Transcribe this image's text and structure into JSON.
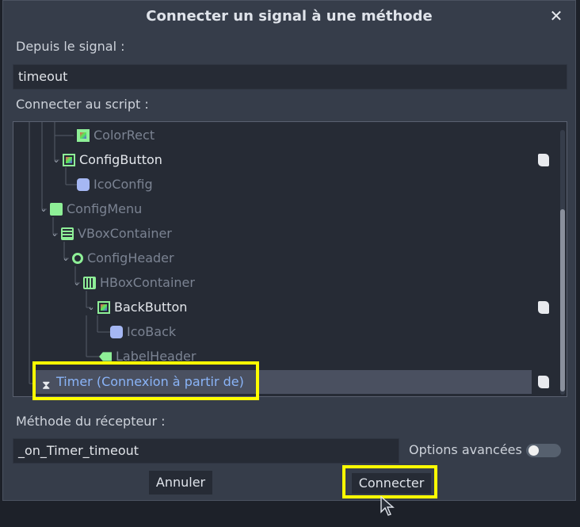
{
  "dialog": {
    "title": "Connecter un signal à une méthode",
    "close_icon": "close-icon"
  },
  "signal_section": {
    "label": "Depuis le signal :",
    "value": "timeout"
  },
  "script_section": {
    "label": "Connecter au script :"
  },
  "tree": {
    "nodes": [
      {
        "label": "ColorRect",
        "icon": "colorrect-icon",
        "dim": true,
        "expanded": false,
        "has_script": false
      },
      {
        "label": "ConfigButton",
        "icon": "texturebutton-icon",
        "dim": false,
        "expanded": true,
        "has_script": true
      },
      {
        "label": "IcoConfig",
        "icon": "sprite-icon",
        "dim": true,
        "expanded": false,
        "has_script": false
      },
      {
        "label": "ConfigMenu",
        "icon": "control-icon",
        "dim": true,
        "expanded": true,
        "has_script": false
      },
      {
        "label": "VBoxContainer",
        "icon": "vbox-icon",
        "dim": true,
        "expanded": true,
        "has_script": false
      },
      {
        "label": "ConfigHeader",
        "icon": "margin-icon",
        "dim": true,
        "expanded": true,
        "has_script": false
      },
      {
        "label": "HBoxContainer",
        "icon": "hbox-icon",
        "dim": true,
        "expanded": true,
        "has_script": false
      },
      {
        "label": "BackButton",
        "icon": "texturebutton-icon",
        "dim": false,
        "expanded": true,
        "has_script": true
      },
      {
        "label": "IcoBack",
        "icon": "sprite-icon",
        "dim": true,
        "expanded": false,
        "has_script": false
      },
      {
        "label": "LabelHeader",
        "icon": "label-icon",
        "dim": true,
        "expanded": false,
        "has_script": false
      }
    ],
    "selected": {
      "label": "Timer (Connexion à partir de)",
      "icon": "hourglass-icon",
      "has_script": true
    }
  },
  "method_section": {
    "label": "Méthode du récepteur :",
    "value": "_on_Timer_timeout",
    "advanced_label": "Options avancées",
    "advanced_enabled": false
  },
  "buttons": {
    "cancel": "Annuler",
    "connect": "Connecter"
  },
  "colors": {
    "highlight": "#ffff00",
    "dialog_bg": "#363d4a",
    "selected_text": "#8ab4f8",
    "node_green": "#8eef97"
  }
}
